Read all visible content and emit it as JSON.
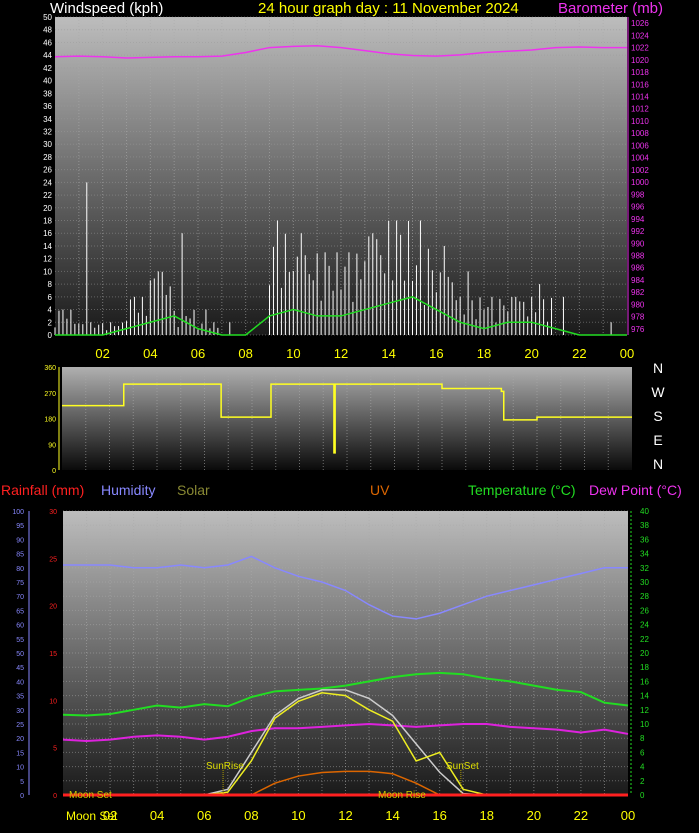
{
  "title": "24 hour graph day : 11 November 2024",
  "colors": {
    "wind": "#ffffff",
    "wind_avg": "#22dd22",
    "barometer": "#ee33ee",
    "direction": "#ffff22",
    "rain": "#ff2020",
    "humidity": "#8888ff",
    "solar": "#eeee22",
    "solar_max": "#cccccc",
    "uv": "#dd6600",
    "temperature": "#22dd22",
    "dewpoint": "#dd22dd",
    "hours": "#ffff00"
  },
  "chart_data": [
    {
      "type": "line",
      "title": "Windspeed (kph)",
      "right_label": "Barometer (mb)",
      "ylim": [
        0,
        50
      ],
      "y2lim": [
        975,
        1027
      ],
      "yticks": [
        0,
        2,
        4,
        6,
        8,
        10,
        12,
        14,
        16,
        18,
        20,
        22,
        24,
        26,
        28,
        30,
        32,
        34,
        36,
        38,
        40,
        42,
        44,
        46,
        48,
        50
      ],
      "y2ticks": [
        976,
        978,
        980,
        982,
        984,
        986,
        988,
        990,
        992,
        994,
        996,
        998,
        1000,
        1002,
        1004,
        1006,
        1008,
        1010,
        1012,
        1014,
        1016,
        1018,
        1020,
        1022,
        1024,
        1026
      ],
      "xticks": [
        "02",
        "04",
        "06",
        "08",
        "10",
        "12",
        "14",
        "16",
        "18",
        "20",
        "22",
        "00"
      ],
      "x_hours": [
        0,
        1,
        2,
        3,
        4,
        5,
        6,
        7,
        8,
        9,
        10,
        11,
        12,
        13,
        14,
        15,
        16,
        17,
        18,
        19,
        20,
        21,
        22,
        23,
        24
      ],
      "series": [
        {
          "name": "Windspeed gust",
          "values": [
            4,
            24,
            2,
            6,
            10,
            16,
            4,
            2,
            0,
            18,
            16,
            13,
            13,
            16,
            18,
            18,
            14,
            10,
            6,
            6,
            8,
            6,
            0,
            2,
            0
          ]
        },
        {
          "name": "Windspeed average",
          "values": [
            0,
            0,
            0,
            1,
            2,
            3,
            1,
            0,
            0,
            3,
            4,
            3,
            3,
            4,
            5,
            6,
            4,
            2,
            1,
            2,
            2,
            1,
            0,
            0,
            0
          ]
        },
        {
          "name": "Barometer (mb)",
          "values": [
            1020.5,
            1020.6,
            1020.5,
            1020.3,
            1020.4,
            1020.5,
            1020.5,
            1020.6,
            1021.2,
            1022,
            1022.2,
            1022.3,
            1022,
            1021.5,
            1021,
            1020.7,
            1020.6,
            1020.8,
            1021.2,
            1021.4,
            1021.6,
            1022,
            1022.1,
            1022,
            1022
          ]
        }
      ]
    },
    {
      "type": "line",
      "title": "Wind direction",
      "ylim": [
        0,
        360
      ],
      "yticks": [
        0,
        90,
        180,
        270,
        360
      ],
      "compass": [
        "N",
        "W",
        "S",
        "E",
        "N"
      ],
      "x_hours": [
        0,
        2,
        2.6,
        6.6,
        6.7,
        8.7,
        8.8,
        11.4,
        11.45,
        11.5,
        15,
        16,
        18.5,
        18.6,
        20,
        24
      ],
      "values": [
        225,
        225,
        300,
        300,
        185,
        185,
        300,
        300,
        60,
        300,
        300,
        285,
        275,
        175,
        185,
        185
      ]
    },
    {
      "type": "line",
      "labels": {
        "rain": "Rainfall (mm)",
        "humidity": "Humidity",
        "solar": "Solar",
        "uv": "UV",
        "temperature": "Temperature (°C)",
        "dewpoint": "Dew Point (°C)"
      },
      "humidity_ticks": [
        0,
        5,
        10,
        15,
        20,
        25,
        30,
        35,
        40,
        45,
        50,
        55,
        60,
        65,
        70,
        75,
        80,
        85,
        90,
        95,
        100
      ],
      "rain_ticks": [
        0,
        5,
        10,
        15,
        20,
        25,
        30
      ],
      "temp_ticks": [
        0,
        2,
        4,
        6,
        8,
        10,
        12,
        14,
        16,
        18,
        20,
        22,
        24,
        26,
        28,
        30,
        32,
        34,
        36,
        38,
        40
      ],
      "xticks": [
        "02",
        "04",
        "06",
        "08",
        "10",
        "12",
        "14",
        "16",
        "18",
        "20",
        "22",
        "00"
      ],
      "x_hours": [
        0,
        1,
        2,
        3,
        4,
        5,
        6,
        7,
        8,
        9,
        10,
        11,
        12,
        13,
        14,
        15,
        16,
        17,
        18,
        19,
        20,
        21,
        22,
        23,
        24
      ],
      "humidity": [
        81,
        81,
        81,
        80,
        80,
        81,
        80,
        81,
        84,
        80,
        77,
        75,
        72,
        67,
        63,
        62,
        64,
        67,
        70,
        72,
        74,
        76,
        78,
        80,
        80
      ],
      "temperature": [
        11.3,
        11.2,
        11.4,
        12,
        12.6,
        12.3,
        12.8,
        12.5,
        13.8,
        14.6,
        14.8,
        15,
        15.4,
        16,
        16.6,
        17,
        17.2,
        17,
        16.4,
        16,
        15.4,
        14.8,
        14.5,
        13,
        12.6
      ],
      "dewpoint": [
        7.8,
        7.6,
        7.8,
        8.2,
        8.4,
        8.2,
        7.8,
        8.2,
        9,
        9.4,
        9.4,
        9.6,
        9.8,
        10,
        9.8,
        9.6,
        9.8,
        10,
        10,
        9.6,
        9.4,
        9.2,
        8.8,
        9.2,
        8.6
      ],
      "rainfall": [
        0,
        0,
        0,
        0,
        0,
        0,
        0,
        0,
        0,
        0,
        0,
        0,
        0,
        0,
        0,
        0,
        0,
        0,
        0,
        0,
        0,
        0,
        0,
        0,
        0
      ],
      "solar": [
        0,
        0,
        0,
        0,
        0,
        0,
        0,
        10,
        120,
        270,
        330,
        360,
        350,
        300,
        260,
        120,
        150,
        20,
        0,
        0,
        0,
        0,
        0,
        0,
        0
      ],
      "solar_max": [
        0,
        0,
        0,
        0,
        0,
        0,
        0,
        20,
        150,
        280,
        340,
        370,
        370,
        340,
        280,
        180,
        80,
        5,
        0,
        0,
        0,
        0,
        0,
        0,
        0
      ],
      "uv": [
        0,
        0,
        0,
        0,
        0,
        0,
        0,
        0,
        0,
        0.5,
        0.8,
        0.95,
        1,
        1,
        0.9,
        0.5,
        0,
        0,
        0,
        0,
        0,
        0,
        0,
        0,
        0
      ],
      "annotations": {
        "sunrise": "SunRise",
        "sunset": "SunSet",
        "moonset": "Moon Set",
        "moonrise": "Moon Rise"
      }
    }
  ]
}
